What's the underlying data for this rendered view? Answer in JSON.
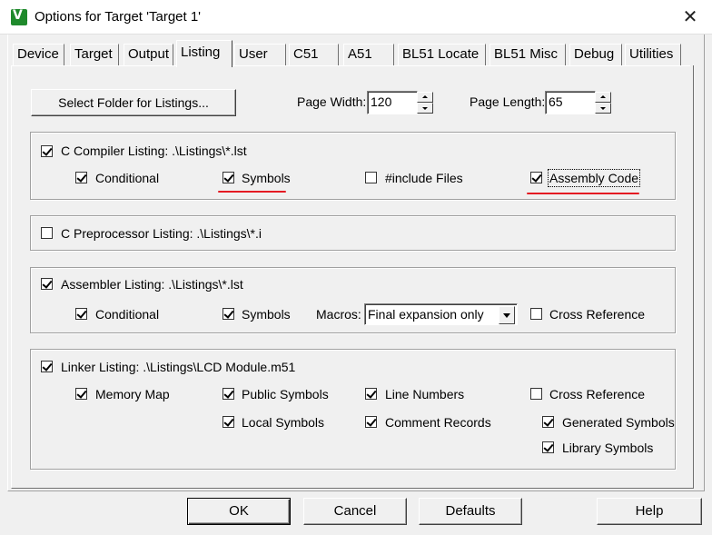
{
  "window": {
    "title": "Options for Target 'Target 1'",
    "app_icon_glyph": "V",
    "close_glyph": "✕"
  },
  "tabs": [
    "Device",
    "Target",
    "Output",
    "Listing",
    "User",
    "C51",
    "A51",
    "BL51 Locate",
    "BL51 Misc",
    "Debug",
    "Utilities"
  ],
  "active_tab": "Listing",
  "top": {
    "select_folder_label": "Select Folder for Listings...",
    "select_folder_accel": "S",
    "page_width_label": "Page Width:",
    "page_width_value": "120",
    "page_length_label": "Page Length:",
    "page_length_value": "65"
  },
  "c_compiler": {
    "label": "C Compiler Listing:  .\\Listings\\*.lst",
    "checked": true,
    "conditional": "Conditional",
    "symbols": "Symbols",
    "include_files": "#include Files",
    "assembly_code": "Assembly Code"
  },
  "c_preprocessor": {
    "label": "C Preprocessor Listing:  .\\Listings\\*.i",
    "checked": false
  },
  "assembler": {
    "label": "Assembler Listing:  .\\Listings\\*.lst",
    "checked": true,
    "conditional": "Conditional",
    "symbols": "Symbols",
    "macros_label": "Macros:",
    "macros_value": "Final expansion only",
    "cross_reference": "Cross Reference"
  },
  "linker": {
    "label": "Linker Listing:  .\\Listings\\LCD Module.m51",
    "checked": true,
    "memory_map": "Memory Map",
    "public_symbols": "Public Symbols",
    "line_numbers": "Line Numbers",
    "cross_reference": "Cross Reference",
    "local_symbols": "Local Symbols",
    "comment_records": "Comment Records",
    "generated_symbols": "Generated Symbols",
    "library_symbols": "Library Symbols"
  },
  "buttons": {
    "ok": "OK",
    "cancel": "Cancel",
    "defaults": "Defaults",
    "help": "Help"
  },
  "colors": {
    "annotation_red": "#e41b23",
    "icon_green": "#1f8a2c"
  }
}
